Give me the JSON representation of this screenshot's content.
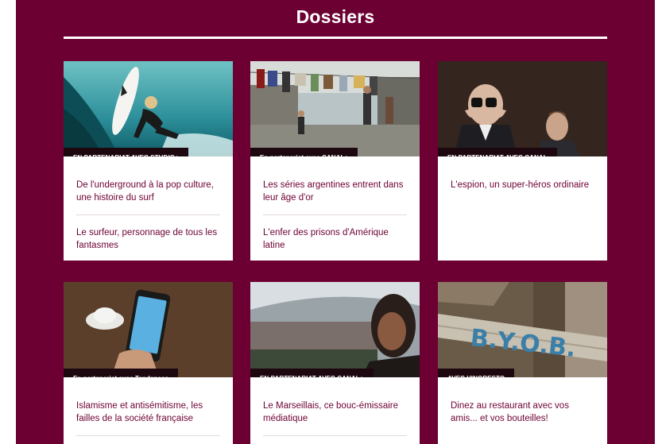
{
  "colors": {
    "background": "#6d0033",
    "badge": "#1d0810",
    "link": "#6d0033"
  },
  "section": {
    "title": "Dossiers"
  },
  "cards": [
    {
      "image": "surfer-photo",
      "badge": "EN PARTENARIAT AVEC STUDIO+",
      "links": [
        "De l'underground à la pop culture, une histoire du surf",
        "Le surfeur, personnage de tous les fantasmes"
      ]
    },
    {
      "image": "favela-laundry-photo",
      "badge": "En partenariat avec CANAL+",
      "links": [
        "Les séries argentines entrent dans leur âge d'or",
        "L'enfer des prisons d'Amérique latine"
      ]
    },
    {
      "image": "spy-binoculars-photo",
      "badge": "EN PARTENARIAT AVEC CANAL",
      "links": [
        "L'espion, un super-héros ordinaire"
      ]
    },
    {
      "image": "smartphone-twitter-photo",
      "badge": "En partenariat avec Tendances",
      "links": [
        "Islamisme et antisémitisme, les failles de la société française"
      ]
    },
    {
      "image": "stadium-woman-photo",
      "badge": "EN PARTENARIAT AVEC CANAL+",
      "links": [
        "Le Marseillais, ce bouc-émissaire médiatique"
      ]
    },
    {
      "image": "byob-sign-photo",
      "badge": "AVEC VINORESTO",
      "links": [
        "Dinez au restaurant avec vos amis... et vos bouteilles!"
      ]
    }
  ]
}
